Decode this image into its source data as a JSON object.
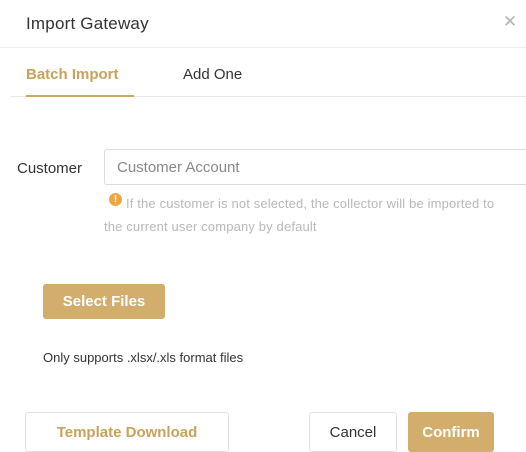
{
  "dialog": {
    "title": "Import Gateway",
    "close_icon": "close-icon",
    "close_glyph": "✕"
  },
  "tabs": [
    {
      "label": "Batch Import",
      "active": true
    },
    {
      "label": "Add One",
      "active": false
    }
  ],
  "form": {
    "customer_label": "Customer",
    "customer_placeholder": "Customer Account",
    "customer_value": "",
    "hint_icon": "warning-icon",
    "hint_icon_glyph": "!",
    "hint_text": "If the customer is not selected, the collector will be imported to the current user company by default"
  },
  "upload": {
    "select_files_label": "Select Files",
    "format_note": "Only supports .xlsx/.xls format files"
  },
  "footer": {
    "template_download_label": "Template Download",
    "cancel_label": "Cancel",
    "confirm_label": "Confirm"
  },
  "colors": {
    "accent": "#d2ad6c",
    "accent_text": "#c9a15c",
    "warning": "#f0a640",
    "hint_text": "#b8b8b8"
  }
}
